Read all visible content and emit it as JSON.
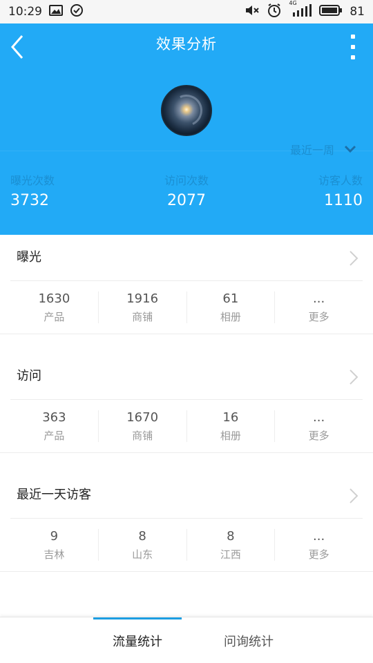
{
  "status_bar": {
    "time": "10:29",
    "battery": "81",
    "network": "4G"
  },
  "header": {
    "title": "效果分析",
    "period_label": "最近一周",
    "stats": [
      {
        "label": "曝光次数",
        "value": "3732"
      },
      {
        "label": "访问次数",
        "value": "2077"
      },
      {
        "label": "访客人数",
        "value": "1110"
      }
    ]
  },
  "sections": [
    {
      "title": "曝光",
      "metrics": [
        {
          "value": "1630",
          "label": "产品"
        },
        {
          "value": "1916",
          "label": "商铺"
        },
        {
          "value": "61",
          "label": "相册"
        },
        {
          "value": "...",
          "label": "更多"
        }
      ]
    },
    {
      "title": "访问",
      "metrics": [
        {
          "value": "363",
          "label": "产品"
        },
        {
          "value": "1670",
          "label": "商铺"
        },
        {
          "value": "16",
          "label": "相册"
        },
        {
          "value": "...",
          "label": "更多"
        }
      ]
    },
    {
      "title": "最近一天访客",
      "metrics": [
        {
          "value": "9",
          "label": "吉林"
        },
        {
          "value": "8",
          "label": "山东"
        },
        {
          "value": "8",
          "label": "江西"
        },
        {
          "value": "...",
          "label": "更多"
        }
      ]
    }
  ],
  "tabs": [
    {
      "label": "流量统计",
      "active": true
    },
    {
      "label": "问询统计",
      "active": false
    }
  ],
  "colors": {
    "header_bg": "#22aaf6",
    "stat_label": "#1b8fd2",
    "tab_indicator": "#1b9de2"
  }
}
